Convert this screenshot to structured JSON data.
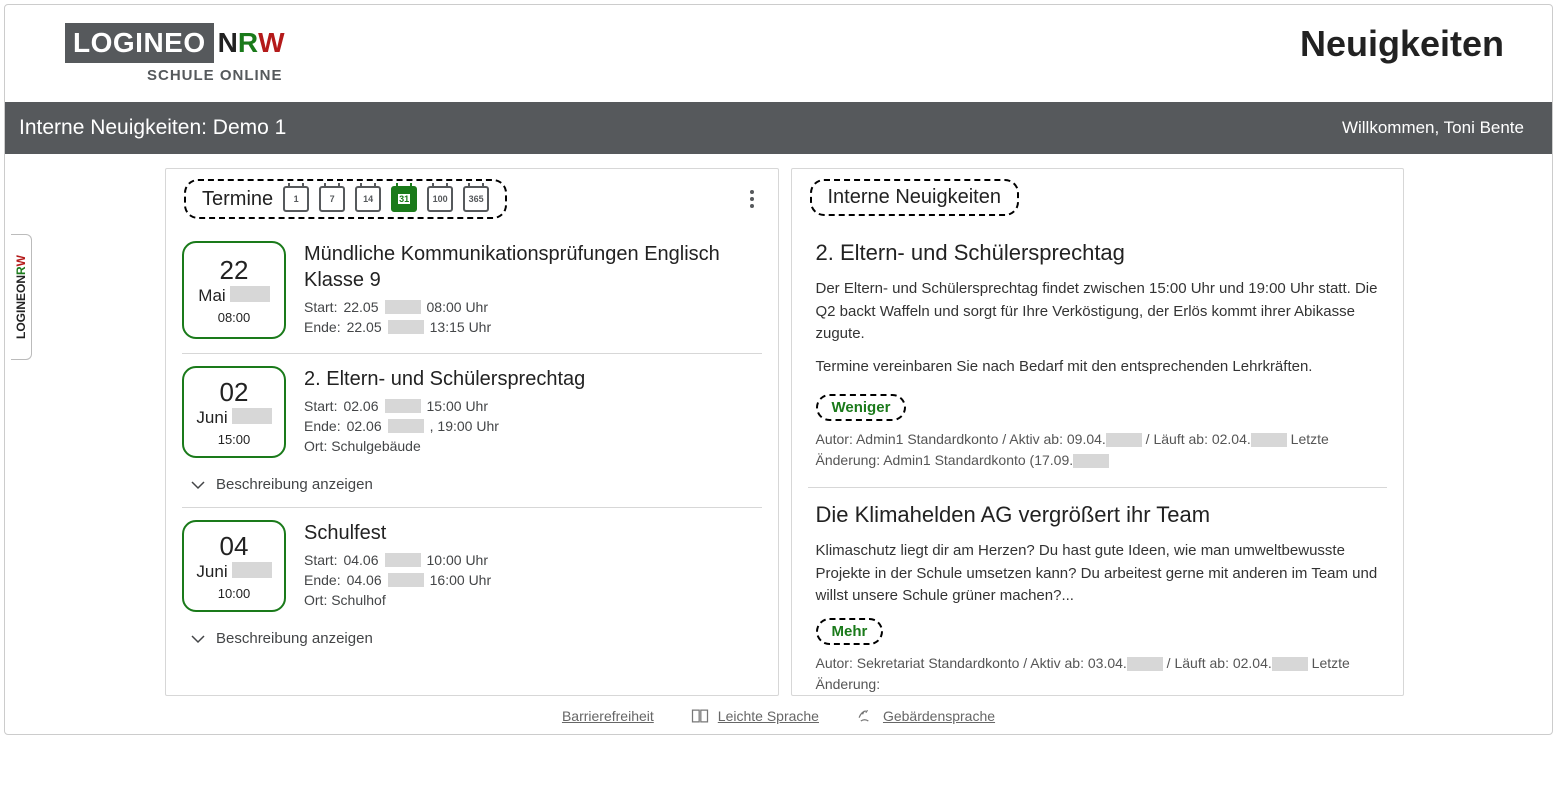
{
  "logo": {
    "dark": "LOGINEO",
    "n": "N",
    "r": "R",
    "w": "W",
    "sub": "SCHULE ONLINE"
  },
  "side_tab": {
    "prefix": "LOGINEO",
    "n": "N",
    "r": "R",
    "w": "W"
  },
  "page_title": "Neuigkeiten",
  "graybar": {
    "left": "Interne Neuigkeiten: Demo 1",
    "welcome": "Willkommen, Toni Bente"
  },
  "termine": {
    "heading": "Termine",
    "filters": [
      "1",
      "7",
      "14",
      "31",
      "100",
      "365"
    ],
    "active_filter_index": 3,
    "desc_toggle_label": "Beschreibung anzeigen",
    "events": [
      {
        "day": "22",
        "month": "Mai",
        "time": "08:00",
        "title": "Mündliche Kommunikationsprüfungen Englisch Klasse 9",
        "start_label": "Start:",
        "start_date": "22.05",
        "start_time": "08:00 Uhr",
        "end_label": "Ende:",
        "end_date": "22.05",
        "end_time": "13:15 Uhr",
        "ort_line": ""
      },
      {
        "day": "02",
        "month": "Juni",
        "time": "15:00",
        "title": "2. Eltern- und Schülersprechtag",
        "start_label": "Start:",
        "start_date": "02.06",
        "start_time": "15:00 Uhr",
        "end_label": "Ende:",
        "end_date": "02.06",
        "end_time": ", 19:00 Uhr",
        "ort_line": "Ort: Schulgebäude"
      },
      {
        "day": "04",
        "month": "Juni",
        "time": "10:00",
        "title": "Schulfest",
        "start_label": "Start:",
        "start_date": "04.06",
        "start_time": "10:00 Uhr",
        "end_label": "Ende:",
        "end_date": "04.06",
        "end_time": "16:00 Uhr",
        "ort_line": "Ort: Schulhof"
      }
    ]
  },
  "news": {
    "heading": "Interne Neuigkeiten",
    "less_label": "Weniger",
    "more_label": "Mehr",
    "items": [
      {
        "title": "2. Eltern- und Schülersprechtag",
        "body1": "Der Eltern- und Schülersprechtag findet zwischen 15:00 Uhr und 19:00 Uhr statt. Die Q2 backt Waffeln und sorgt für Ihre Verköstigung, der Erlös kommt ihrer Abikasse zugute.",
        "body2": "Termine vereinbaren Sie nach Bedarf mit den entsprechenden Lehrkräften.",
        "expanded": true,
        "meta_1": "Autor: Admin1 Standardkonto / Aktiv ab: 09.04.",
        "meta_2": " / Läuft ab: 02.04.",
        "meta_3": " Letzte Änderung: Admin1 Standardkonto (17.09."
      },
      {
        "title": "Die Klimahelden AG vergrößert ihr Team",
        "body1": "Klimaschutz liegt dir am Herzen? Du hast gute Ideen, wie man umweltbewusste Projekte in der Schule umsetzen kann? Du arbeitest gerne mit anderen im Team und willst unsere Schule grüner machen?...",
        "body2": "",
        "expanded": false,
        "meta_1": "Autor: Sekretariat Standardkonto / Aktiv ab: 03.04.",
        "meta_2": " / Läuft ab: 02.04.",
        "meta_3": " Letzte Änderung:"
      }
    ]
  },
  "footer": {
    "barrierefreiheit": "Barrierefreiheit",
    "leichte_sprache": "Leichte Sprache",
    "gebaerdensprache": "Gebärdensprache"
  }
}
